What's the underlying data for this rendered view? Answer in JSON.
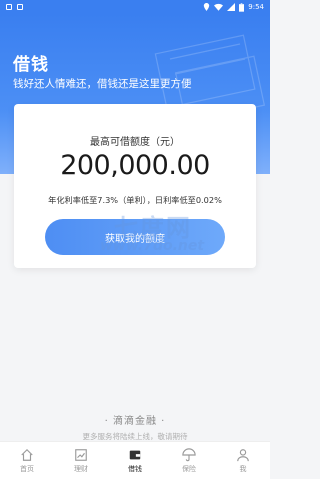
{
  "status_bar": {
    "time": "9:54"
  },
  "hero": {
    "title": "借钱",
    "subtitle": "钱好还人情难还，借钱还是这里更方便"
  },
  "card": {
    "label": "最高可借额度（元）",
    "amount": "200,000.00",
    "rate_text": "年化利率低至7.3%（单利），日利率低至0.02%",
    "button_label": "获取我的额度"
  },
  "watermark": {
    "cn": "七度网",
    "url": "www.7do.net"
  },
  "footer": {
    "brand": "· 滴滴金融 ·",
    "note": "更多服务将陆续上线，敬请期待"
  },
  "tabs": [
    {
      "label": "首页",
      "icon": "home-icon"
    },
    {
      "label": "理财",
      "icon": "chart-icon"
    },
    {
      "label": "借钱",
      "icon": "wallet-icon"
    },
    {
      "label": "保险",
      "icon": "umbrella-icon"
    },
    {
      "label": "我",
      "icon": "person-icon"
    }
  ],
  "active_tab": "借钱",
  "colors": {
    "accent": "#3a7ff0",
    "button": "#5a9bf6"
  }
}
